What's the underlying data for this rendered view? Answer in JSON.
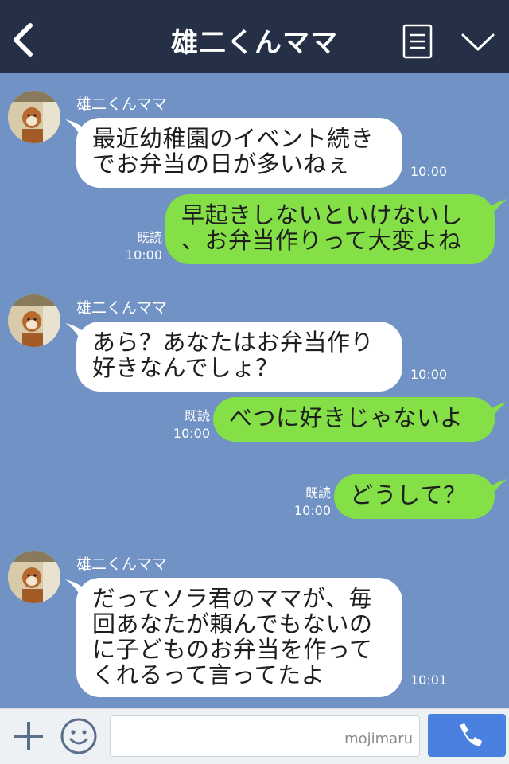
{
  "header": {
    "title": "雄二くんママ",
    "back_icon": "chevron-left-icon",
    "menu_icon": "menu-list-icon",
    "expand_icon": "chevron-down-icon",
    "bg_color": "#253046"
  },
  "chat": {
    "bg_color": "#7092c4",
    "incoming_color": "#ffffff",
    "outgoing_color": "#84e046",
    "messages": [
      {
        "sender": "雄二くんママ",
        "lines": [
          "最近幼稚園のイベント続き",
          "でお弁当の日が多いねぇ"
        ],
        "time": "10:00"
      },
      {
        "lines": [
          "早起きしないといけないし",
          "、お弁当作りって大変よね"
        ],
        "read": "既読",
        "time": "10:00"
      },
      {
        "sender": "雄二くんママ",
        "lines": [
          "あら？あなたはお弁当作り",
          "好きなんでしょ？"
        ],
        "time": "10:00"
      },
      {
        "lines": [
          "べつに好きじゃないよ"
        ],
        "read": "既読",
        "time": "10:00"
      },
      {
        "lines": [
          "どうして？"
        ],
        "read": "既読",
        "time": "10:00"
      },
      {
        "sender": "雄二くんママ",
        "lines": [
          "だってソラ君のママが、毎",
          "回あなたが頼んでもないの",
          "に子どものお弁当を作って",
          "くれるって言ってたよ"
        ],
        "time": "10:01"
      }
    ]
  },
  "inputbar": {
    "plus_icon": "plus-icon",
    "emoji_icon": "emoji-icon",
    "watermark": "mojimaru",
    "call_icon": "phone-icon",
    "call_color": "#4a80e0"
  }
}
